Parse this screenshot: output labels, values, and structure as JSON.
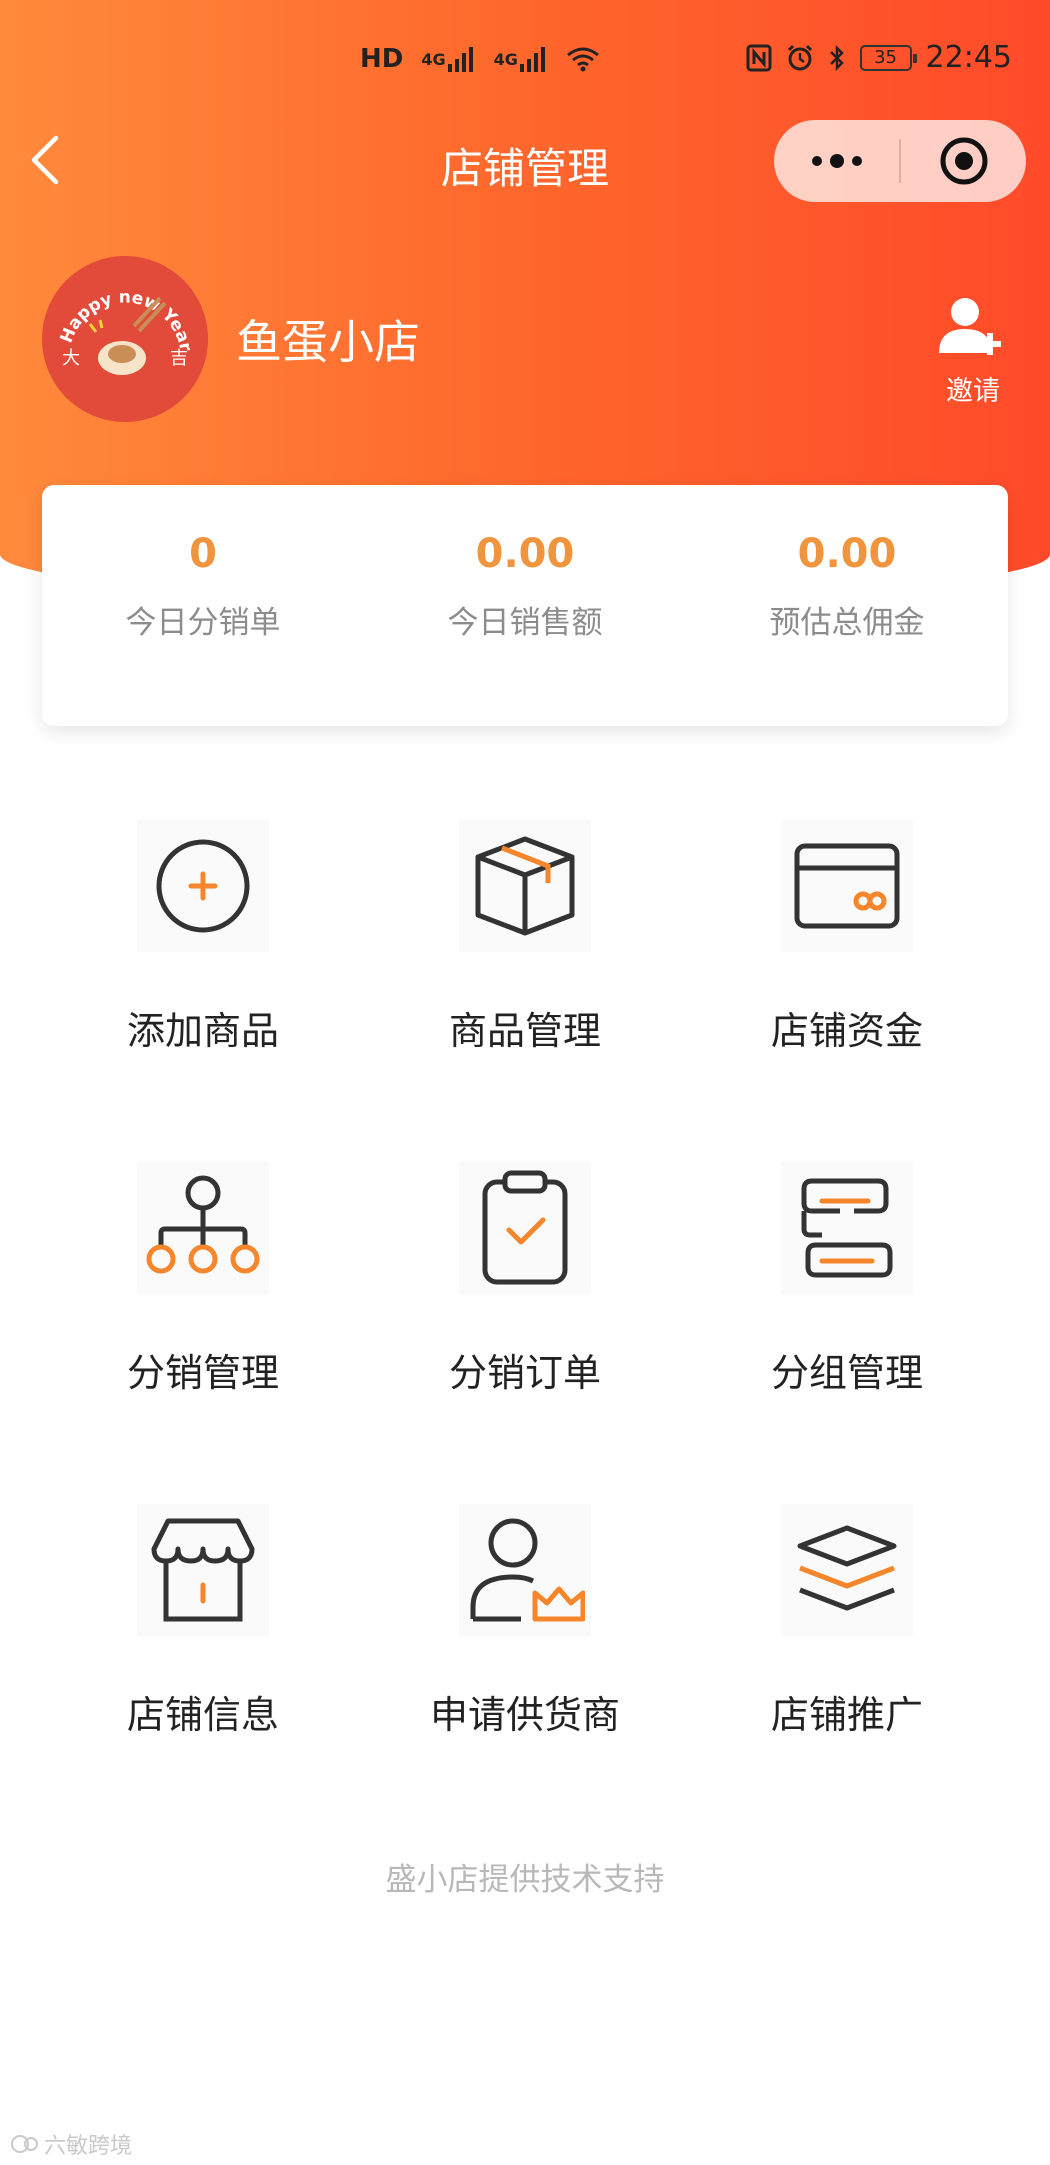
{
  "status_bar": {
    "left_indicators": [
      "HD",
      "4G",
      "4G"
    ],
    "battery": "35",
    "time": "22:45"
  },
  "nav": {
    "title": "店铺管理"
  },
  "shop": {
    "name": "鱼蛋小店",
    "avatar_text": "Happy new Year",
    "avatar_left": "大",
    "avatar_right": "吉",
    "invite_label": "邀请"
  },
  "stats": [
    {
      "value": "0",
      "label": "今日分销单"
    },
    {
      "value": "0.00",
      "label": "今日销售额"
    },
    {
      "value": "0.00",
      "label": "预估总佣金"
    }
  ],
  "menu": [
    {
      "label": "添加商品",
      "icon": "add-circle-icon"
    },
    {
      "label": "商品管理",
      "icon": "box-icon"
    },
    {
      "label": "店铺资金",
      "icon": "wallet-card-icon"
    },
    {
      "label": "分销管理",
      "icon": "hierarchy-icon"
    },
    {
      "label": "分销订单",
      "icon": "clipboard-check-icon"
    },
    {
      "label": "分组管理",
      "icon": "group-icon"
    },
    {
      "label": "店铺信息",
      "icon": "storefront-icon"
    },
    {
      "label": "申请供货商",
      "icon": "user-crown-icon"
    },
    {
      "label": "店铺推广",
      "icon": "layers-icon"
    }
  ],
  "footer": "盛小店提供技术支持",
  "watermark": "六敏跨境",
  "colors": {
    "header_start": "#ff8a3c",
    "header_end": "#ff4a2a",
    "accent_orange": "#f0953e",
    "icon_orange": "#f5862b",
    "icon_dark": "#333333"
  }
}
